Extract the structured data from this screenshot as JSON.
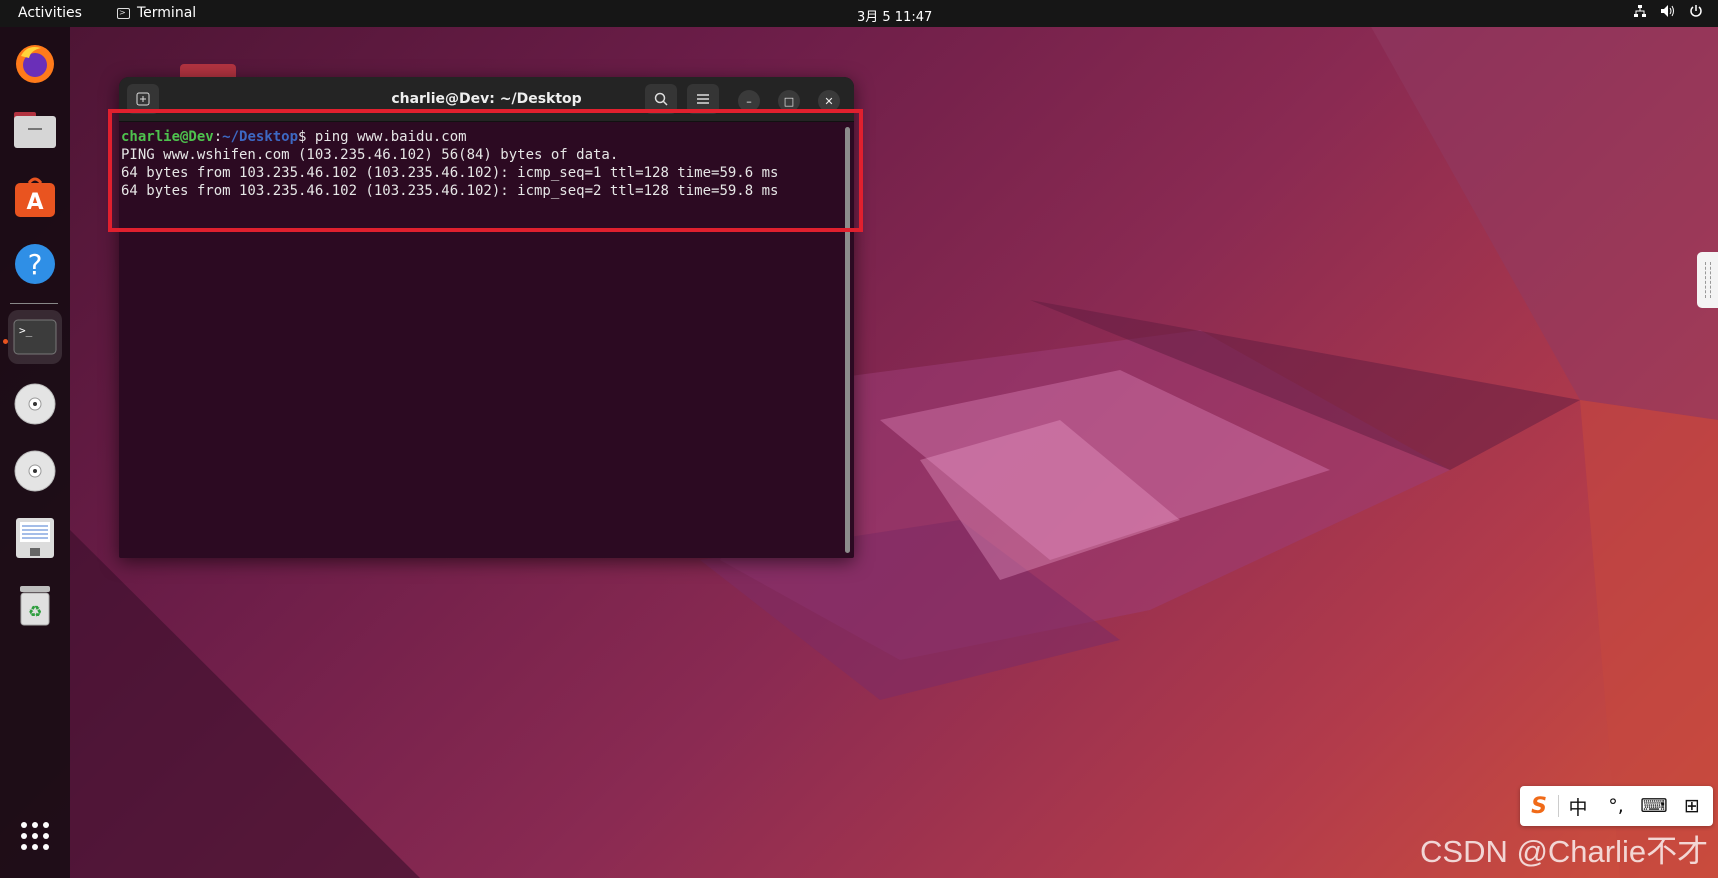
{
  "topbar": {
    "activities": "Activities",
    "app_name": "Terminal",
    "clock": "3月 5  11:47",
    "icons": [
      "network-icon",
      "volume-icon",
      "power-icon"
    ]
  },
  "dock": {
    "items": [
      {
        "name": "firefox-icon"
      },
      {
        "name": "files-icon"
      },
      {
        "name": "app-center-icon"
      },
      {
        "name": "help-icon"
      },
      {
        "name": "terminal-icon",
        "active": true
      },
      {
        "name": "optical-disc-icon"
      },
      {
        "name": "optical-disc-icon"
      },
      {
        "name": "text-editor-icon"
      },
      {
        "name": "trash-icon"
      },
      {
        "name": "show-apps-icon"
      }
    ]
  },
  "terminal": {
    "title": "charlie@Dev: ~/Desktop",
    "prompt_user": "charlie@Dev",
    "prompt_sep": ":",
    "prompt_path": "~/Desktop",
    "prompt_symbol": "$ ",
    "command": "ping www.baidu.com",
    "output": [
      "PING www.wshifen.com (103.235.46.102) 56(84) bytes of data.",
      "64 bytes from 103.235.46.102 (103.235.46.102): icmp_seq=1 ttl=128 time=59.6 ms",
      "64 bytes from 103.235.46.102 (103.235.46.102): icmp_seq=2 ttl=128 time=59.8 ms"
    ],
    "minimize_glyph": "–",
    "maximize_glyph": "□",
    "close_glyph": "✕"
  },
  "ime": {
    "logo": "S",
    "mode": "中",
    "punct": "°,",
    "keyboard": "⌨",
    "grid": "⊞"
  },
  "watermark": "CSDN @Charlie不才",
  "colors": {
    "accent": "#e95420",
    "highlight": "#e0202e",
    "terminal_bg": "#2c0a22"
  }
}
